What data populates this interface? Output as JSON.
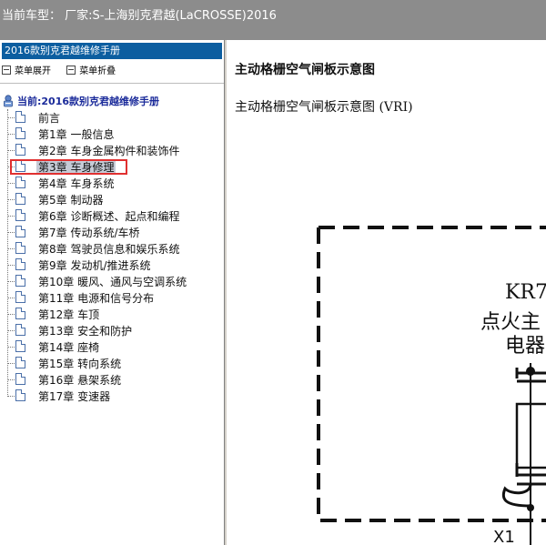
{
  "topbar": {
    "title": "当前车型： 厂家:S-上海别克君越(LaCROSSE)2016"
  },
  "left_pane": {
    "header": "2016款别克君越维修手册",
    "toolbar": {
      "expand_label": "菜单展开",
      "collapse_label": "菜单折叠"
    },
    "root_label": "当前:2016款别克君越维修手册",
    "items": [
      {
        "label": "前言"
      },
      {
        "label": "第1章 一般信息"
      },
      {
        "label": "第2章 车身金属构件和装饰件"
      },
      {
        "label": "第3章 车身修理"
      },
      {
        "label": "第4章 车身系统"
      },
      {
        "label": "第5章 制动器"
      },
      {
        "label": "第6章 诊断概述、起点和编程"
      },
      {
        "label": "第7章 传动系统/车桥"
      },
      {
        "label": "第8章 驾驶员信息和娱乐系统"
      },
      {
        "label": "第9章 发动机/推进系统"
      },
      {
        "label": "第10章 暖风、通风与空调系统"
      },
      {
        "label": "第11章 电源和信号分布"
      },
      {
        "label": "第12章 车顶"
      },
      {
        "label": "第13章 安全和防护"
      },
      {
        "label": "第14章 座椅"
      },
      {
        "label": "第15章 转向系统"
      },
      {
        "label": "第16章 悬架系统"
      },
      {
        "label": "第17章 变速器"
      }
    ],
    "selected_item": "第3章 车身修理"
  },
  "content": {
    "title": "主动格栅空气闸板示意图",
    "subtitle": "主动格栅空气闸板示意图 (VRI)",
    "diagram": {
      "label_kr": "KR7",
      "label_line2": "点火主",
      "label_line3": "电器",
      "label_connector": "X1"
    }
  },
  "colors": {
    "topbar_bg": "#8c8c8c",
    "header_bg": "#0c5ea0",
    "root_label": "#1a2a9a",
    "highlight": "#e03030"
  },
  "icons": {
    "toolbar": "box-minus-icon",
    "root": "manual-book-icon",
    "item": "document-icon"
  }
}
